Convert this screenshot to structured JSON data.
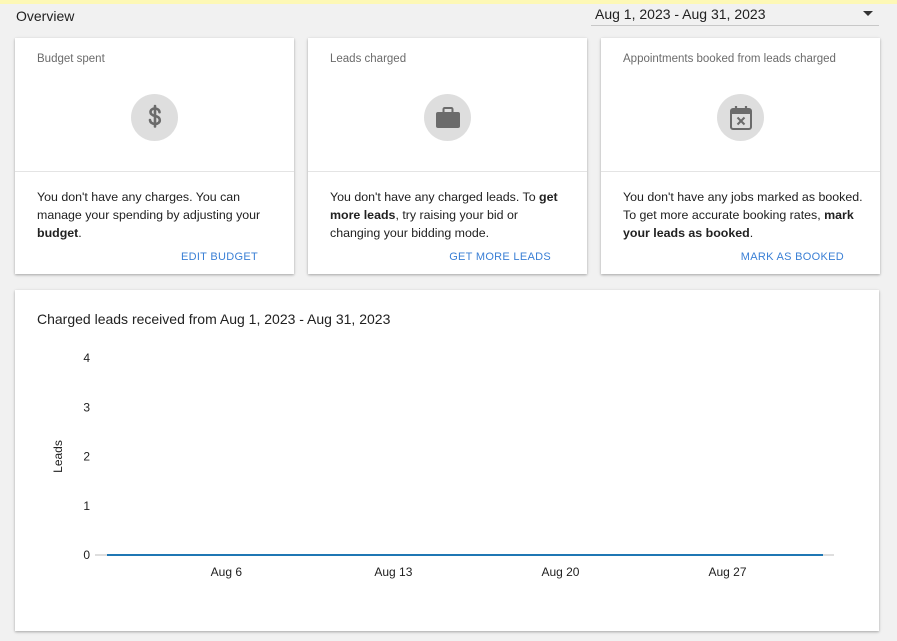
{
  "header": {
    "title": "Overview",
    "date_range": "Aug 1, 2023 - Aug 31, 2023"
  },
  "cards": [
    {
      "label": "Budget spent",
      "icon": "dollar-icon",
      "message_parts": [
        "You don't have any charges. You can manage your spending by adjusting your ",
        "budget",
        "."
      ],
      "action": "EDIT BUDGET"
    },
    {
      "label": "Leads charged",
      "icon": "briefcase-icon",
      "message_parts": [
        "You don't have any charged leads. To ",
        "get more leads",
        ", try raising your bid or changing your bidding mode."
      ],
      "action": "GET MORE LEADS"
    },
    {
      "label": "Appointments booked from leads charged",
      "icon": "calendar-x-icon",
      "message_parts": [
        "You don't have any jobs marked as booked. To get more accurate booking rates, ",
        "mark your leads as booked",
        "."
      ],
      "action": "MARK AS BOOKED"
    }
  ],
  "chart_data": {
    "type": "line",
    "title": "Charged leads received from Aug 1, 2023 - Aug 31, 2023",
    "ylabel": "Leads",
    "xlabel": "",
    "ylim": [
      0,
      4
    ],
    "yticks": [
      "0",
      "1",
      "2",
      "3",
      "4"
    ],
    "xticks": [
      "Aug 6",
      "Aug 13",
      "Aug 20",
      "Aug 27"
    ],
    "x_range": [
      "2023-08-01",
      "2023-08-31"
    ],
    "series": [
      {
        "values": [
          0,
          0,
          0,
          0,
          0,
          0,
          0,
          0,
          0,
          0,
          0,
          0,
          0,
          0,
          0,
          0,
          0,
          0,
          0,
          0,
          0,
          0,
          0,
          0,
          0,
          0,
          0,
          0,
          0,
          0,
          0
        ],
        "color": "#1f77b4"
      }
    ],
    "grid": false
  },
  "colors": {
    "accent": "#3a7fd5",
    "line": "#1f77b4",
    "icon_bg": "#dedede",
    "icon_fg": "#6b6b6b"
  }
}
